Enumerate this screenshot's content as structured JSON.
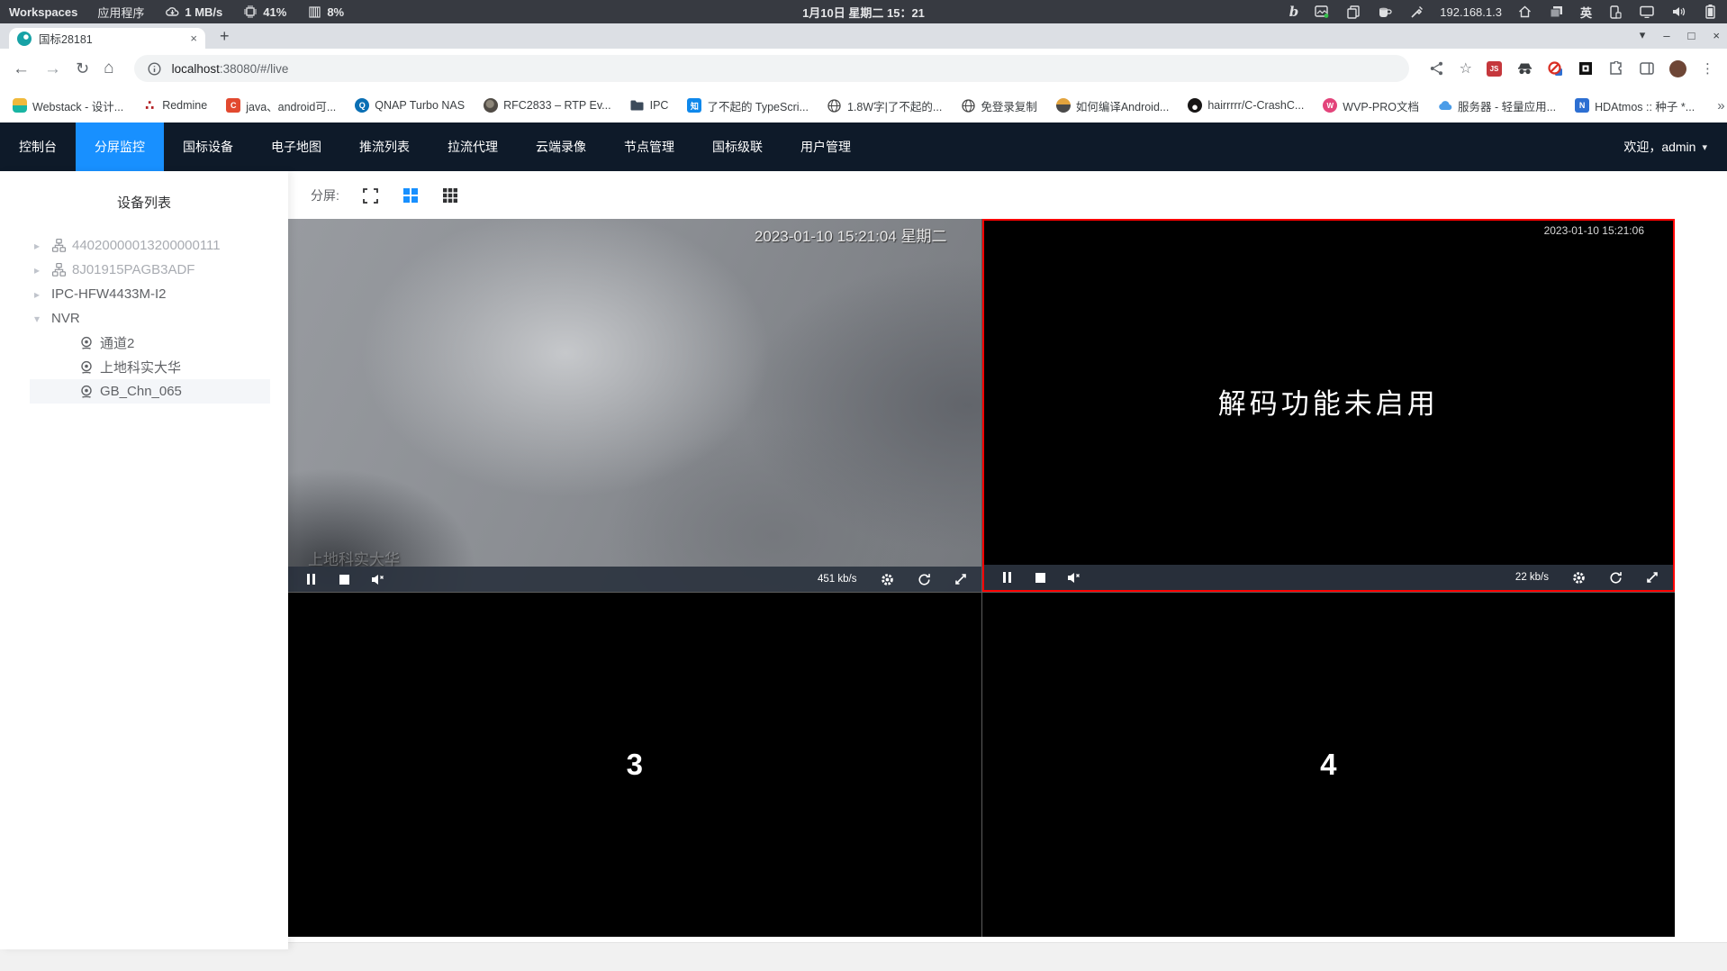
{
  "colors": {
    "accent": "#1890ff",
    "nav_bg": "#0e1a29",
    "selected_video_border": "#ff0000"
  },
  "taskbar": {
    "workspaces": "Workspaces",
    "applications": "应用程序",
    "net_speed": "1 MB/s",
    "cpu": "41%",
    "mem": "8%",
    "clock": "1月10日 星期二 15：21",
    "ip": "192.168.1.3",
    "ime": "英"
  },
  "browser": {
    "tab_title": "国标28181",
    "url_host": "localhost",
    "url_rest": ":38080/#/live",
    "bookmarks": [
      {
        "label": "Webstack - 设计..."
      },
      {
        "label": "Redmine"
      },
      {
        "label": "java、android可..."
      },
      {
        "label": "QNAP Turbo NAS"
      },
      {
        "label": "RFC2833 – RTP Ev..."
      },
      {
        "label": "IPC"
      },
      {
        "label": "了不起的 TypeScri..."
      },
      {
        "label": "1.8W字|了不起的..."
      },
      {
        "label": "免登录复制"
      },
      {
        "label": "如何编译Android..."
      },
      {
        "label": "hairrrrr/C-CrashC..."
      },
      {
        "label": "WVP-PRO文档"
      },
      {
        "label": "服务器 - 轻量应用..."
      },
      {
        "label": "HDAtmos :: 种子 *..."
      }
    ]
  },
  "icons": {
    "back": "←",
    "forward": "→",
    "reload": "↻",
    "home": "⌂",
    "star": "☆",
    "close_tab": "×",
    "new_tab": "+",
    "chevron_down": "▾",
    "minimize": "–",
    "maximize": "□",
    "close_win": "×",
    "more": "⋮",
    "overflow": "»",
    "caret_right": "▸",
    "caret_down": "▾",
    "redmine_glyph": "∴",
    "c_glyph": "C",
    "q_glyph": "Q",
    "zhihu_glyph": "知",
    "w_glyph": "W",
    "n_glyph": "N",
    "js_glyph": "JS"
  },
  "app": {
    "nav": [
      "控制台",
      "分屏监控",
      "国标设备",
      "电子地图",
      "推流列表",
      "拉流代理",
      "云端录像",
      "节点管理",
      "国标级联",
      "用户管理"
    ],
    "welcome": "欢迎，admin"
  },
  "sidebar": {
    "title": "设备列表",
    "items": [
      {
        "label": "44020000013200000111"
      },
      {
        "label": "8J01915PAGB3ADF"
      },
      {
        "label": "IPC-HFW4433M-I2"
      },
      {
        "label": "NVR"
      },
      {
        "label": "通道2"
      },
      {
        "label": "上地科实大华"
      },
      {
        "label": "GB_Chn_065"
      }
    ]
  },
  "split": {
    "label": "分屏:"
  },
  "videos": {
    "v1": {
      "timestamp": "2023-01-10 15:21:04 星期二",
      "osd": "上地科实大华",
      "bitrate": "451 kb/s"
    },
    "v2": {
      "timestamp": "2023-01-10 15:21:06",
      "message": "解码功能未启用",
      "bitrate": "22 kb/s"
    },
    "v3": {
      "label": "3"
    },
    "v4": {
      "label": "4"
    }
  }
}
